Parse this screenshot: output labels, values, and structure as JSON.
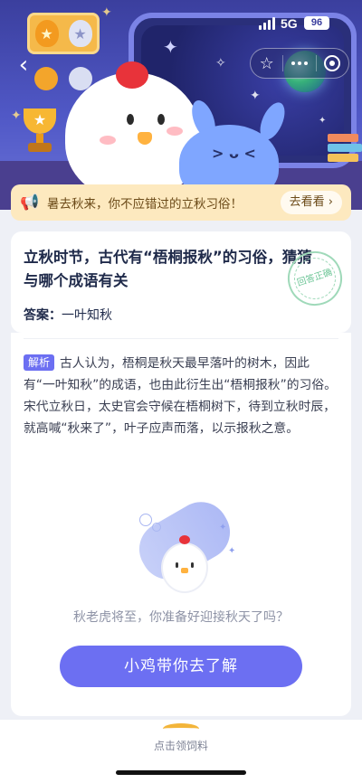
{
  "status_bar": {
    "network": "5G",
    "battery": "96"
  },
  "nav": {
    "back_icon": "chevron-left-icon",
    "capsule_icons": [
      "star-icon",
      "more-dots-icon",
      "target-icon"
    ]
  },
  "banner": {
    "icon": "megaphone-icon",
    "text": "暑去秋来，你不应错过的立秋习俗！",
    "button_label": "去看看 ›"
  },
  "question_card": {
    "question": "立秋时节，古代有“梧桐报秋”的习俗，猜猜与哪个成语有关",
    "answer_label": "答案：",
    "answer_value": "一叶知秋",
    "stamp_text": "回答正确"
  },
  "explanation": {
    "tag": "解析",
    "text": "古人认为，梧桐是秋天最早落叶的树木，因此有“一叶知秋”的成语，也由此衍生出“梧桐报秋”的习俗。宋代立秋日，太史官会守候在梧桐树下，待到立秋时辰，就高喊“秋来了”，叶子应声而落，以示报秋之意。",
    "prompt": "秋老虎将至，你准备好迎接秋天了吗？",
    "cta_label": "小鸡带你去了解"
  },
  "bottom_bar": {
    "icon": "feed-bowl-icon",
    "label": "点击领饲料"
  },
  "colors": {
    "hero_top": "#3b3f9e",
    "accent": "#6c6ff2",
    "banner_bg": "#fde9bf",
    "stamp": "#6cc596"
  }
}
